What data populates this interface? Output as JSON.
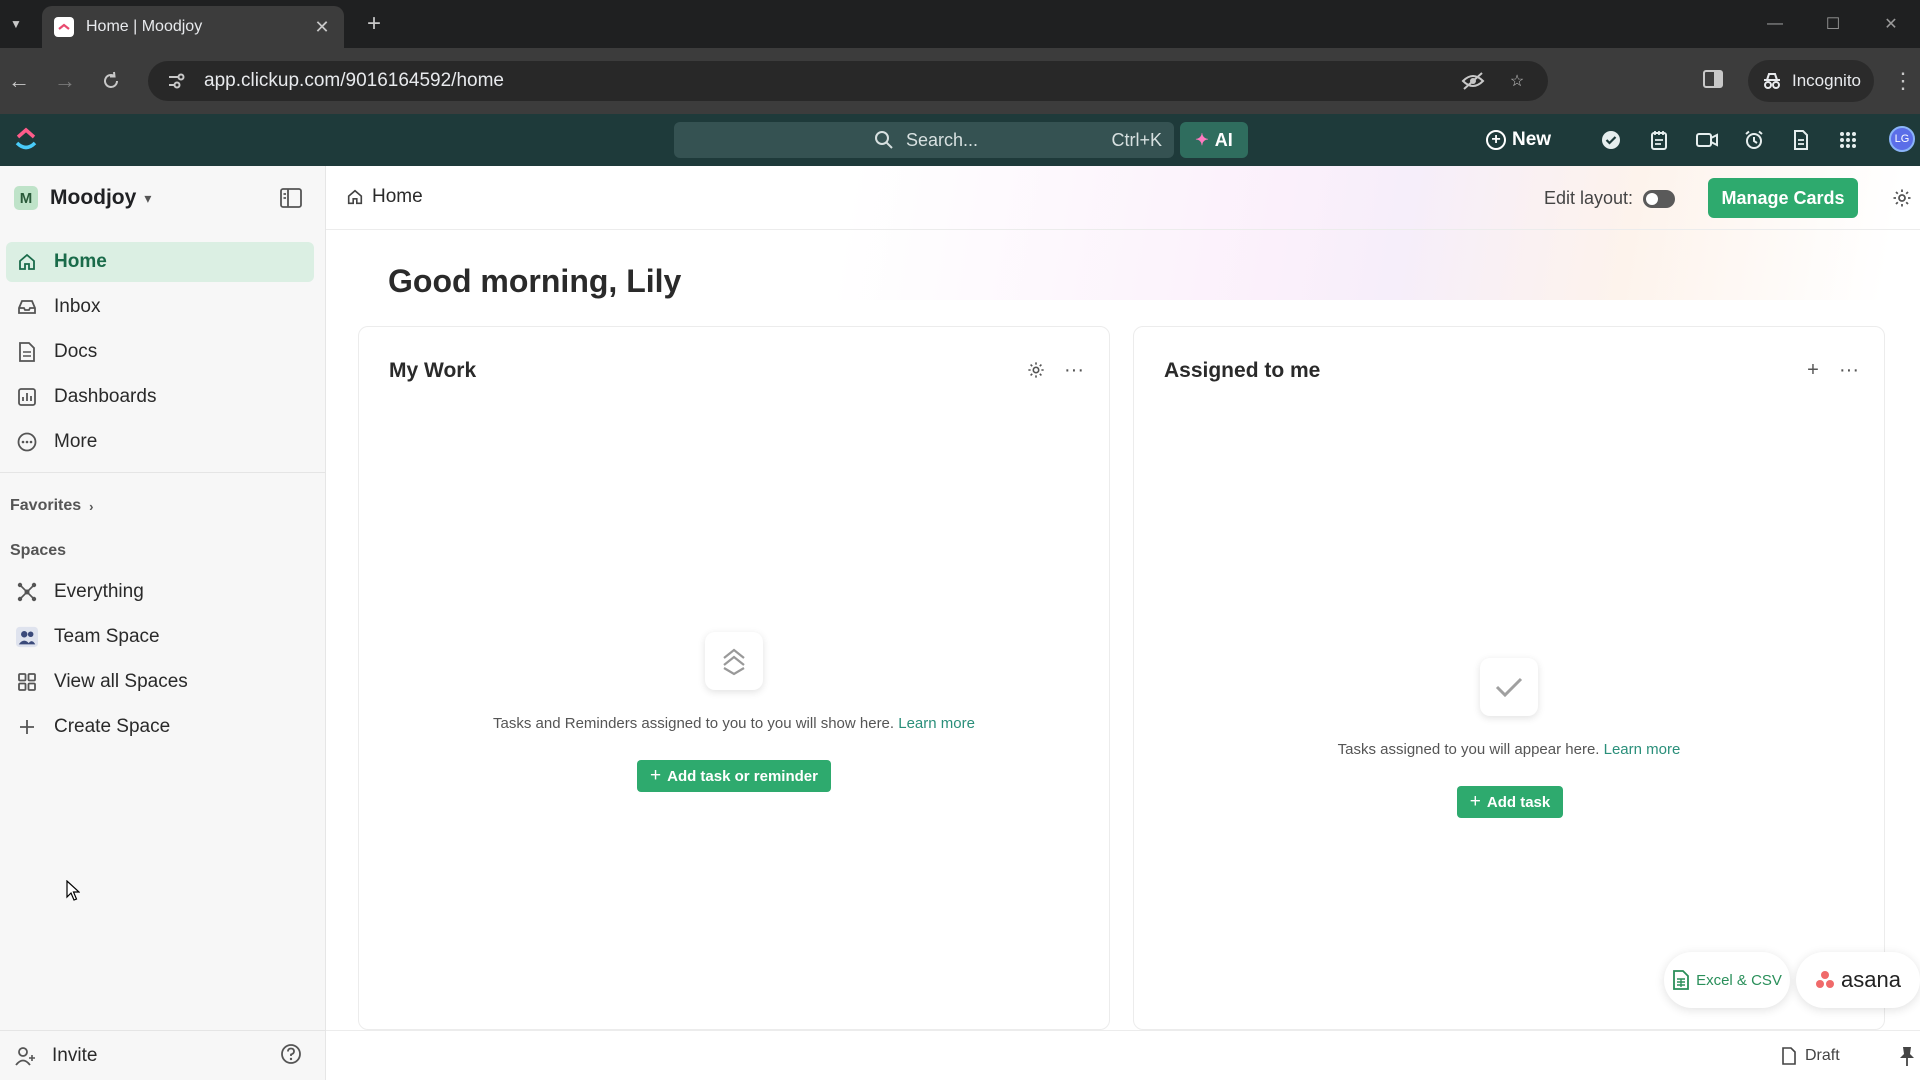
{
  "browser": {
    "tab_title": "Home | Moodjoy",
    "url": "app.clickup.com/9016164592/home",
    "incognito_label": "Incognito"
  },
  "topbar": {
    "search_placeholder": "Search...",
    "search_shortcut": "Ctrl+K",
    "ai_label": "AI",
    "new_label": "New",
    "avatar_initials": "LG"
  },
  "sidebar": {
    "workspace_initial": "M",
    "workspace_name": "Moodjoy",
    "nav": [
      {
        "label": "Home",
        "icon": "home-icon",
        "active": true
      },
      {
        "label": "Inbox",
        "icon": "inbox-icon"
      },
      {
        "label": "Docs",
        "icon": "docs-icon"
      },
      {
        "label": "Dashboards",
        "icon": "dashboards-icon"
      },
      {
        "label": "More",
        "icon": "more-icon"
      }
    ],
    "favorites_label": "Favorites",
    "spaces_label": "Spaces",
    "spaces": [
      {
        "label": "Everything",
        "icon": "everything-icon"
      },
      {
        "label": "Team Space",
        "icon": "team-icon"
      },
      {
        "label": "View all Spaces",
        "icon": "grid-icon"
      },
      {
        "label": "Create Space",
        "icon": "plus-icon"
      }
    ],
    "invite_label": "Invite"
  },
  "page": {
    "breadcrumb": "Home",
    "edit_layout_label": "Edit layout:",
    "manage_cards_label": "Manage Cards",
    "greeting": "Good morning, Lily"
  },
  "cards": {
    "my_work": {
      "title": "My Work",
      "empty_text": "Tasks and Reminders assigned to you to you will show here.",
      "learn_more": "Learn more",
      "button_label": "Add task or reminder"
    },
    "assigned": {
      "title": "Assigned to me",
      "empty_text": "Tasks assigned to you will appear here.",
      "learn_more": "Learn more",
      "button_label": "Add task"
    }
  },
  "imports": {
    "excel_label": "Excel & CSV",
    "asana_label": "asana"
  },
  "footer": {
    "draft_label": "Draft"
  },
  "colors": {
    "accent_green": "#2eaa6e",
    "topbar_bg": "#1e3a3a",
    "link": "#2a8f7a"
  }
}
